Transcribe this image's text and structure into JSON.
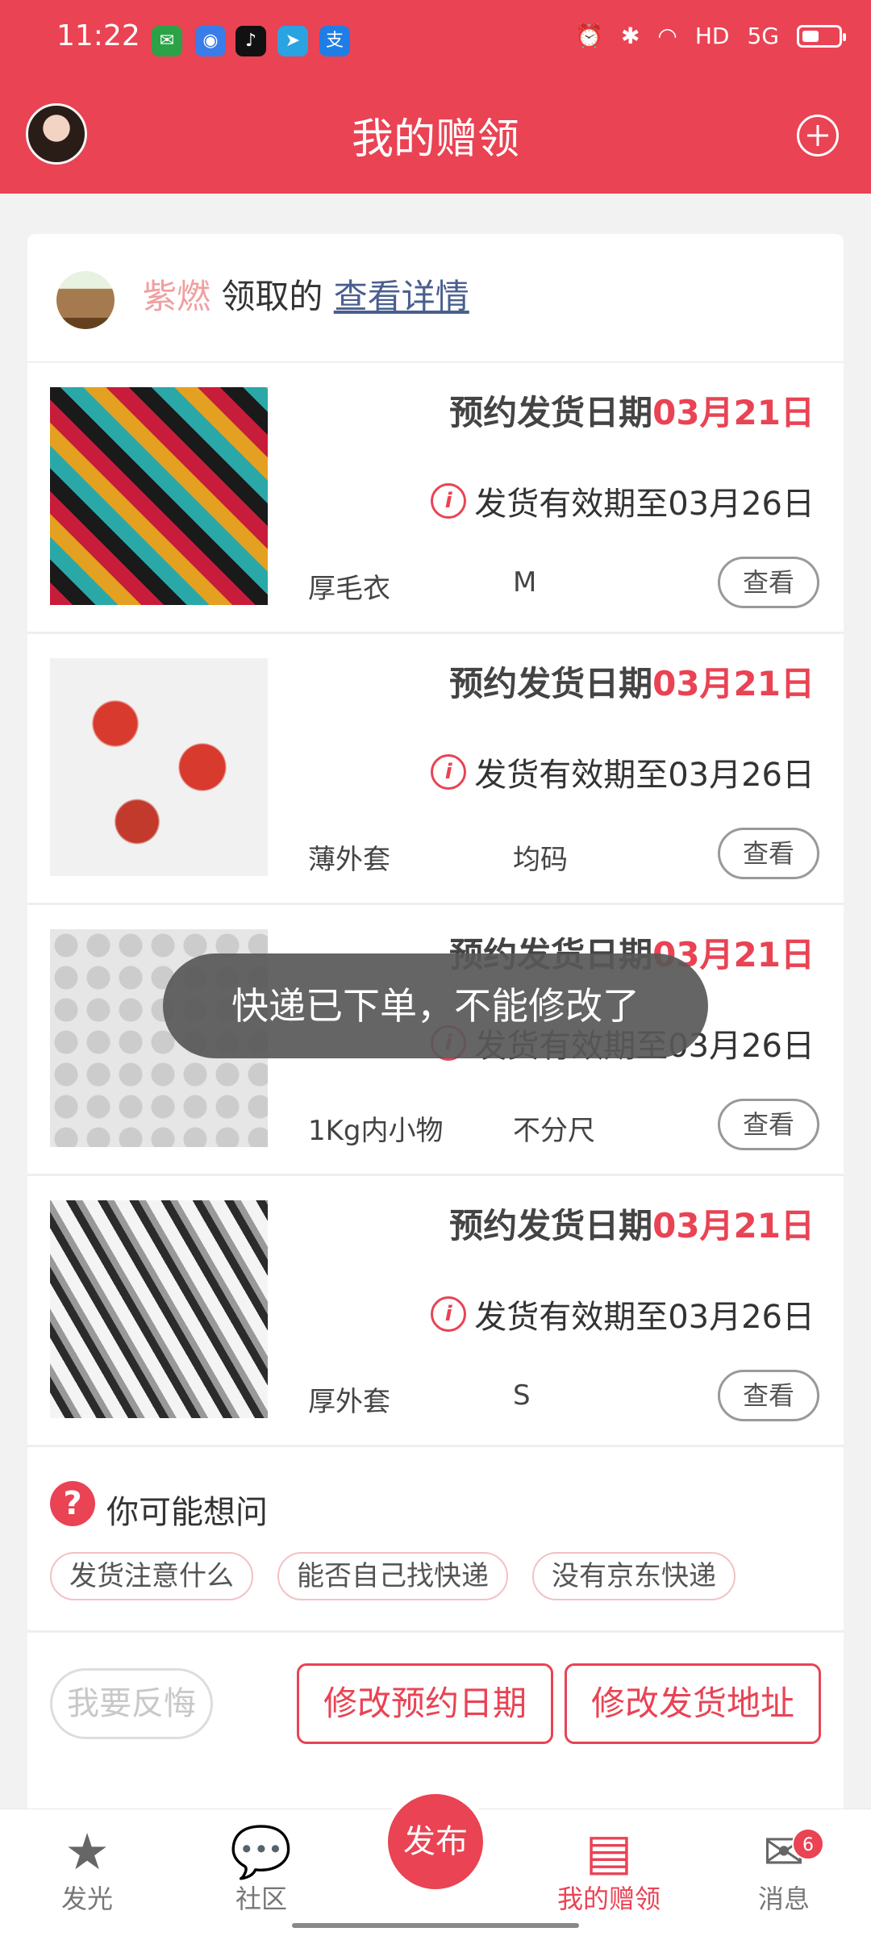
{
  "status": {
    "time": "11:22",
    "apps": [
      "wechat-icon",
      "baidu-icon",
      "tiktok-icon",
      "telegram-icon",
      "alipay-icon"
    ],
    "right_icons": [
      "alarm-icon",
      "bluetooth-icon",
      "wifi-icon",
      "hd-icon",
      "5g-signal-icon",
      "battery-icon"
    ],
    "hd": "HD",
    "net": "5G"
  },
  "header": {
    "title": "我的赠领"
  },
  "card": {
    "giver_name": "紫燃",
    "verb": "领取的",
    "detail_link": "查看详情",
    "items": [
      {
        "ship_label": "预约发货日期",
        "ship_date": "03月21日",
        "valid_text": "发货有效期至03月26日",
        "name": "厚毛衣",
        "size": "M",
        "view": "查看"
      },
      {
        "ship_label": "预约发货日期",
        "ship_date": "03月21日",
        "valid_text": "发货有效期至03月26日",
        "name": "薄外套",
        "size": "均码",
        "view": "查看"
      },
      {
        "ship_label": "预约发货日期",
        "ship_date": "03月21日",
        "valid_text": "发货有效期至03月26日",
        "name": "1Kg内小物",
        "size": "不分尺",
        "view": "查看"
      },
      {
        "ship_label": "预约发货日期",
        "ship_date": "03月21日",
        "valid_text": "发货有效期至03月26日",
        "name": "厚外套",
        "size": "S",
        "view": "查看"
      }
    ],
    "faq": {
      "title": "你可能想问",
      "tags": [
        "发货注意什么",
        "能否自己找快递",
        "没有京东快递"
      ]
    },
    "actions": {
      "regret": "我要反悔",
      "change_date": "修改预约日期",
      "change_address": "修改发货地址"
    }
  },
  "toast": "快递已下单，不能修改了",
  "nav": {
    "items": [
      {
        "label": "发光",
        "icon": "star-icon"
      },
      {
        "label": "社区",
        "icon": "chat-icon"
      },
      {
        "label": "发布",
        "icon": "publish-icon"
      },
      {
        "label": "我的赠领",
        "icon": "gift-box-icon"
      },
      {
        "label": "消息",
        "icon": "mail-icon"
      }
    ],
    "badge": "6"
  },
  "colors": {
    "brand": "#e94354"
  }
}
